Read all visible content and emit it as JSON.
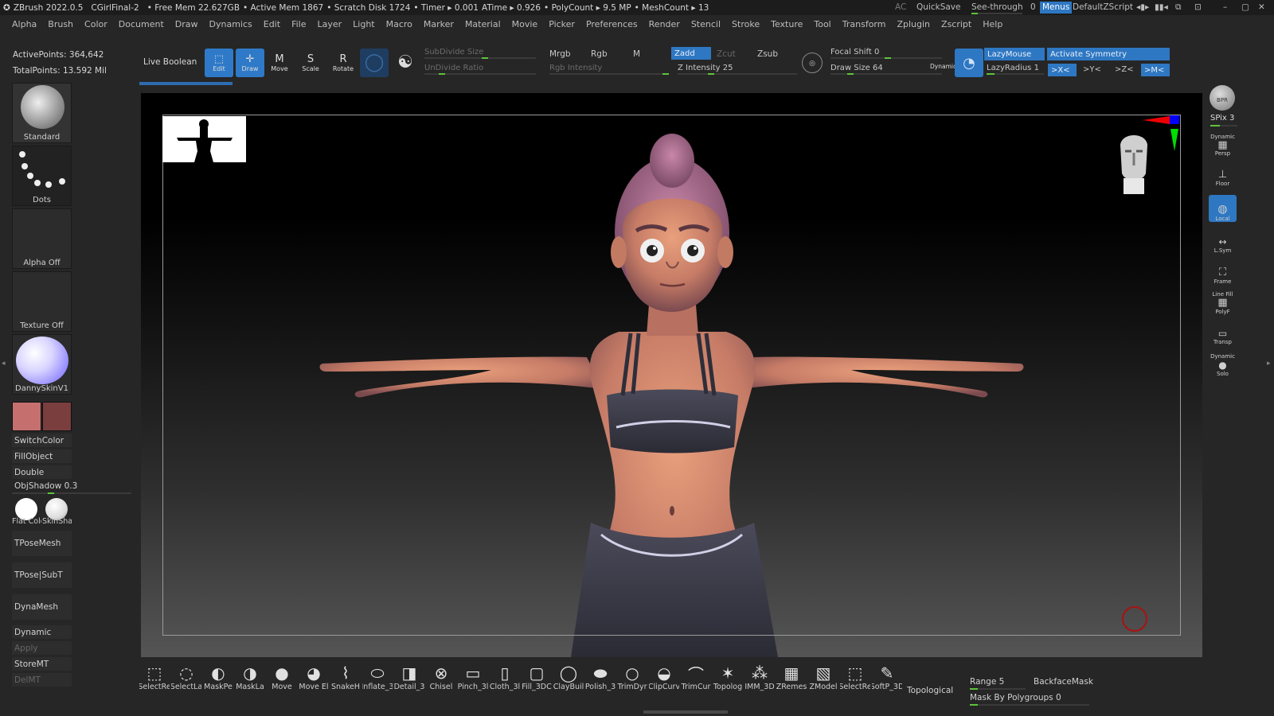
{
  "titlebar": {
    "app": "ZBrush 2022.0.5",
    "doc": "CGirlFinal-2",
    "free_mem": "• Free Mem 22.627GB",
    "active_mem": "• Active Mem 1867",
    "scratch": "• Scratch Disk 1724",
    "timer": "• Timer ▸ 0.001",
    "atime": "ATime ▸ 0.926",
    "polycount": "• PolyCount ▸ 9.5 MP",
    "meshcount": "• MeshCount ▸ 13",
    "ac": "AC",
    "quicksave": "QuickSave",
    "seethrough_label": "See-through",
    "seethrough_value": "0",
    "menus": "Menus",
    "default_zscript": "DefaultZScript"
  },
  "menu": [
    "Alpha",
    "Brush",
    "Color",
    "Document",
    "Draw",
    "Dynamics",
    "Edit",
    "File",
    "Layer",
    "Light",
    "Macro",
    "Marker",
    "Material",
    "Movie",
    "Picker",
    "Preferences",
    "Render",
    "Stencil",
    "Stroke",
    "Texture",
    "Tool",
    "Transform",
    "Zplugin",
    "Zscript",
    "Help"
  ],
  "stats": {
    "active_points": "ActivePoints: 364,642",
    "total_points": "TotalPoints: 13.592 Mil"
  },
  "shelf": {
    "live_boolean": "Live Boolean",
    "edit": "Edit",
    "draw": "Draw",
    "move": "Move",
    "scale": "Scale",
    "rotate": "Rotate",
    "subdivide": "SubDivide Size",
    "undivide": "UnDivide Ratio",
    "mrgb": "Mrgb",
    "rgb": "Rgb",
    "m": "M",
    "rgb_intensity": "Rgb Intensity",
    "zadd": "Zadd",
    "zcut": "Zcut",
    "zsub": "Zsub",
    "z_intensity": "Z Intensity 25",
    "focal_shift": "Focal Shift 0",
    "draw_size": "Draw Size 64",
    "dynamic": "Dynamic",
    "lazymouse": "LazyMouse",
    "lazyradius": "LazyRadius 1",
    "activate_symmetry": "Activate Symmetry",
    "sym_x": ">X<",
    "sym_y": ">Y<",
    "sym_z": ">Z<",
    "sym_m": ">M<",
    "z_intensity_fill": 0.25,
    "draw_size_fill": 0.15
  },
  "left": {
    "brush": "Standard",
    "stroke": "Dots",
    "alpha": "Alpha Off",
    "texture": "Texture Off",
    "material": "DannySkinV1",
    "switch_color": "SwitchColor",
    "fill_object": "FillObject",
    "double": "Double",
    "obj_shadow": "ObjShadow 0.3",
    "flat_color": "Flat Colc",
    "skin_shade": "SkinSha",
    "tpose_mesh": "TPoseMesh",
    "tpose_subt": "TPose|SubT",
    "dynamesh": "DynaMesh",
    "dynamic": "Dynamic",
    "apply": "Apply",
    "store_mt": "StoreMT",
    "del_mt": "DelMT",
    "main_color": "#c66f6f",
    "secondary_color": "#7a3e3e"
  },
  "right": {
    "bpr": "BPR",
    "spix": "SPix 3",
    "persp": "Persp",
    "persp_top": "Dynamic",
    "floor": "Floor",
    "local": "Local",
    "lsym": "L.Sym",
    "frame": "Frame",
    "polyf": "PolyF",
    "polyf_top": "Line Fill",
    "transp": "Transp",
    "solo": "Solo",
    "solo_top": "Dynamic"
  },
  "bottom": {
    "brushes": [
      "SelectRe",
      "SelectLa",
      "MaskPe",
      "MaskLa",
      "Move",
      "Move El",
      "SnakeH",
      "Inflate_3",
      "Detail_3",
      "Chisel",
      "Pinch_3l",
      "Cloth_3l",
      "Fill_3DC",
      "ClayBuil",
      "Polish_3",
      "TrimDyr",
      "ClipCurv",
      "TrimCur",
      "Topolog",
      "IMM_3D",
      "ZRemes",
      "ZModel",
      "SelectRe",
      "SoftP_3D"
    ],
    "topological": "Topological",
    "range": "Range 5",
    "backface": "BackfaceMask",
    "mask_by_polygroups": "Mask By Polygroups 0"
  }
}
